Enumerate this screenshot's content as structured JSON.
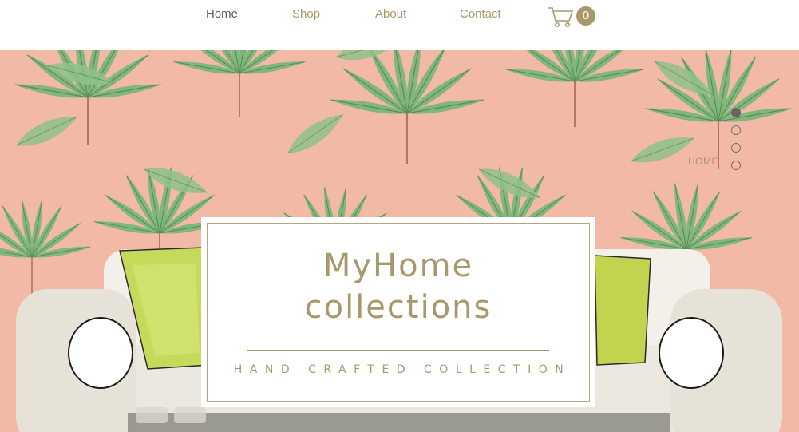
{
  "nav": {
    "items": [
      {
        "label": "Home",
        "active": true
      },
      {
        "label": "Shop",
        "active": false
      },
      {
        "label": "About",
        "active": false
      },
      {
        "label": "Contact",
        "active": false
      }
    ],
    "cart_count": "0",
    "cart_icon": "shopping-cart-icon"
  },
  "slideshow": {
    "current_label": "HOME",
    "dot_count": 4,
    "active_index": 0
  },
  "hero": {
    "title_line1": "MyHome",
    "title_line2": "collections",
    "subtitle": "HAND CRAFTED COLLECTION"
  },
  "colors": {
    "accent": "#a8986c",
    "hero_background": "#f2b9a6",
    "leaf_green": "#6ea86a",
    "sofa": "#ece8df"
  }
}
